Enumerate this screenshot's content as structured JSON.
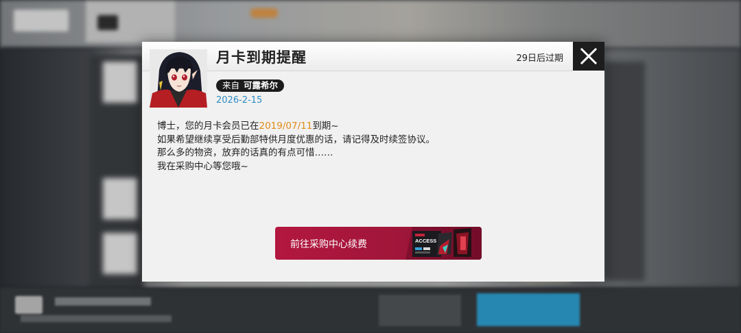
{
  "dialog": {
    "title": "月卡到期提醒",
    "expire_text": "29日后过期",
    "sender_prefix": "来自",
    "sender_name": "可露希尔",
    "date": "2026-2-15",
    "body": {
      "line1_before": "博士，您的月卡会员已在",
      "line1_date": "2019/07/11",
      "line1_after": "到期~",
      "line2": "如果希望继续享受后勤部特供月度优惠的话，请记得及时续签协议。",
      "line3": "那么多的物资，放弃的话真的有点可惜……",
      "line4": "我在采购中心等您哦~"
    },
    "cta_label": "前往采购中心续费",
    "cta_art_text": "ACCESS"
  },
  "colors": {
    "accent_orange": "#e28a14",
    "date_blue": "#2b8bc4",
    "cta_red": "#b3173f",
    "close_bg": "#1d1d1d"
  },
  "icons": {
    "close": "close-icon",
    "avatar": "character-avatar"
  }
}
